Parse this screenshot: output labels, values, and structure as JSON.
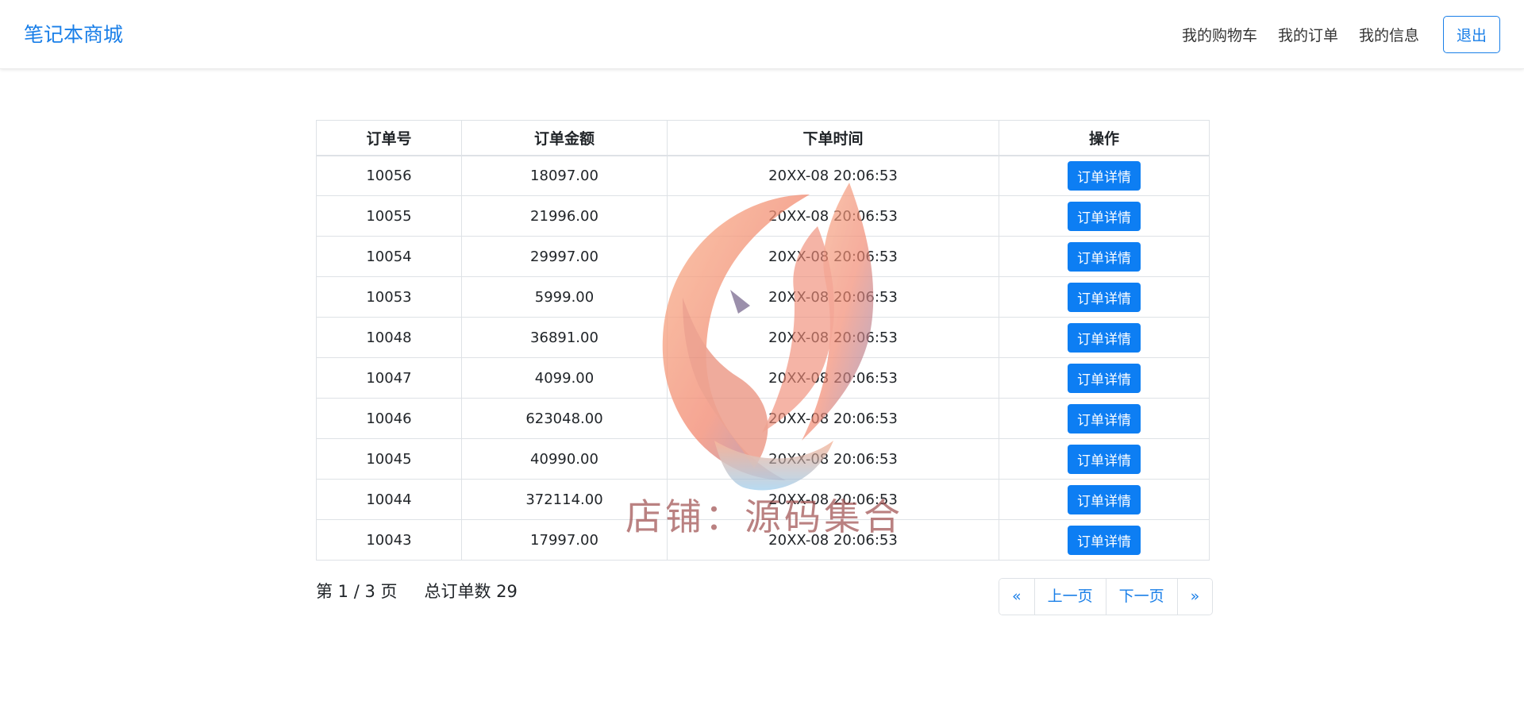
{
  "header": {
    "brand": "笔记本商城",
    "nav": [
      "我的购物车",
      "我的订单",
      "我的信息"
    ],
    "logout_label": "退出"
  },
  "table": {
    "columns": [
      "订单号",
      "订单金额",
      "下单时间",
      "操作"
    ],
    "rows": [
      {
        "id": "10056",
        "amount": "18097.00",
        "time": "20XX-08 20:06:53",
        "action": "订单详情"
      },
      {
        "id": "10055",
        "amount": "21996.00",
        "time": "20XX-08 20:06:53",
        "action": "订单详情"
      },
      {
        "id": "10054",
        "amount": "29997.00",
        "time": "20XX-08 20:06:53",
        "action": "订单详情"
      },
      {
        "id": "10053",
        "amount": "5999.00",
        "time": "20XX-08 20:06:53",
        "action": "订单详情"
      },
      {
        "id": "10048",
        "amount": "36891.00",
        "time": "20XX-08 20:06:53",
        "action": "订单详情"
      },
      {
        "id": "10047",
        "amount": "4099.00",
        "time": "20XX-08 20:06:53",
        "action": "订单详情"
      },
      {
        "id": "10046",
        "amount": "623048.00",
        "time": "20XX-08 20:06:53",
        "action": "订单详情"
      },
      {
        "id": "10045",
        "amount": "40990.00",
        "time": "20XX-08 20:06:53",
        "action": "订单详情"
      },
      {
        "id": "10044",
        "amount": "372114.00",
        "time": "20XX-08 20:06:53",
        "action": "订单详情"
      },
      {
        "id": "10043",
        "amount": "17997.00",
        "time": "20XX-08 20:06:53",
        "action": "订单详情"
      }
    ]
  },
  "footer": {
    "page_text": "第 1 / 3 页",
    "total_text": "总订单数 29"
  },
  "pagination": {
    "first": "«",
    "prev": "上一页",
    "next": "下一页",
    "last": "»"
  },
  "watermark": {
    "text": "店铺：源码集合",
    "icon": "phoenix-icon"
  },
  "colors": {
    "primary": "#0d7ef3",
    "brand": "#1a7fe8",
    "border": "#dee2e6"
  }
}
